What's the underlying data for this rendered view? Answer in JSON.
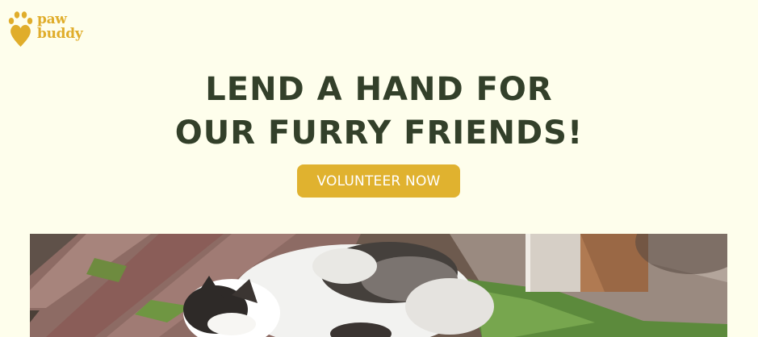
{
  "brand": {
    "line1": "paw",
    "line2": "buddy",
    "color": "#e0ad2b",
    "icon": "paw-heart-icon"
  },
  "hero": {
    "title_line1": "LEND A HAND FOR",
    "title_line2": "OUR FURRY FRIENDS!",
    "title_color": "#33402a",
    "cta_label": "VOLUNTEER NOW",
    "cta_color": "#e0b22f"
  },
  "photo": {
    "subject": "cat-photo"
  },
  "page": {
    "background": "#fefeec"
  }
}
